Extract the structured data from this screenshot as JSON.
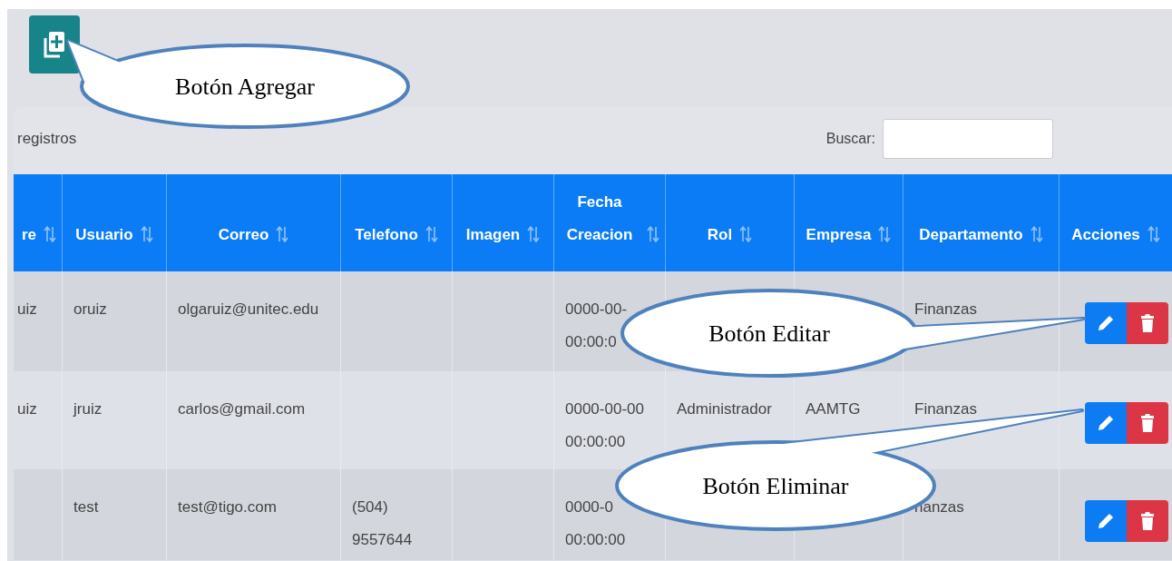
{
  "add_button": {
    "kind": "add"
  },
  "length_label": "registros",
  "search": {
    "label": "Buscar:"
  },
  "table": {
    "columns": [
      "re",
      "Usuario",
      "Correo",
      "Telefono",
      "Imagen",
      "Fecha Creacion",
      "Rol",
      "Empresa",
      "Departamento",
      "Acciones"
    ],
    "rows": [
      {
        "column_1": "uiz",
        "usuario": "oruiz",
        "correo": "olgaruiz@unitec.edu",
        "fecha_creacion": [
          "0000-00-",
          "00:00:0"
        ],
        "departamento": "Finanzas"
      },
      {
        "column_1": "uiz",
        "usuario": "jruiz",
        "correo": "carlos@gmail.com",
        "fecha_creacion": [
          "0000-00-00",
          "00:00:00"
        ],
        "rol": "Administrador",
        "empresa": "AAMTG",
        "departamento": "Finanzas"
      },
      {
        "usuario": "test",
        "correo": "test@tigo.com",
        "telefono": [
          "(504)",
          "9557644"
        ],
        "fecha_creacion": [
          "0000-0",
          "00:00:00"
        ],
        "departamento": "nanzas"
      }
    ]
  },
  "callouts": [
    {
      "text": "Botón Agregar"
    },
    {
      "text": "Botón Editar"
    },
    {
      "text": "Botón Eliminar"
    }
  ]
}
